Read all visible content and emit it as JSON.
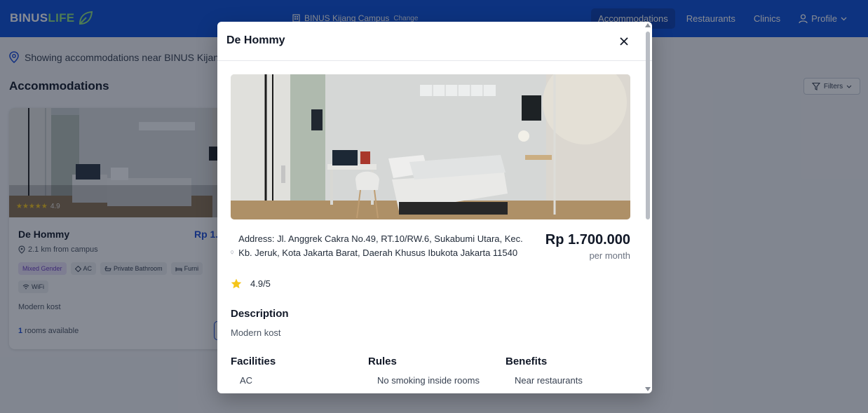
{
  "navbar": {
    "brand_part1": "BINUS",
    "brand_part2": "LIFE",
    "campus": "BINUS Kijang Campus",
    "change": "Change",
    "links": [
      "Accommodations",
      "Restaurants",
      "Clinics"
    ],
    "profile": "Profile",
    "active_link": "Accommodations"
  },
  "page": {
    "location_text": "Showing accommodations near BINUS Kijang",
    "section_title": "Accommodations",
    "filters": "Filters"
  },
  "card": {
    "name": "De Hommy",
    "price": "Rp 1.",
    "rating_stars": "★★★★★",
    "rating": "4.9",
    "distance": "2.1 km from campus",
    "tags": [
      "Mixed Gender",
      "AC",
      "Private Bathroom",
      "Furni",
      "WiFi"
    ],
    "description": "Modern kost",
    "rooms_count": "1",
    "rooms_label": " rooms available"
  },
  "modal": {
    "title": "De Hommy",
    "address": "Address: Jl. Anggrek Cakra No.49, RT.10/RW.6, Sukabumi Utara, Kec. Kb. Jeruk, Kota Jakarta Barat, Daerah Khusus Ibukota Jakarta 11540",
    "price": "Rp 1.700.000",
    "per": "per month",
    "rating": "4.9/5",
    "description_heading": "Description",
    "description": "Modern kost",
    "facilities_heading": "Facilities",
    "facilities": [
      "AC"
    ],
    "rules_heading": "Rules",
    "rules": [
      "No smoking inside rooms"
    ],
    "benefits_heading": "Benefits",
    "benefits": [
      "Near restaurants"
    ]
  },
  "colors": {
    "nav": "#0b4fd6",
    "accent": "#1d4ed8",
    "star": "#f5c518",
    "gender_tag": "#ede4fb"
  }
}
